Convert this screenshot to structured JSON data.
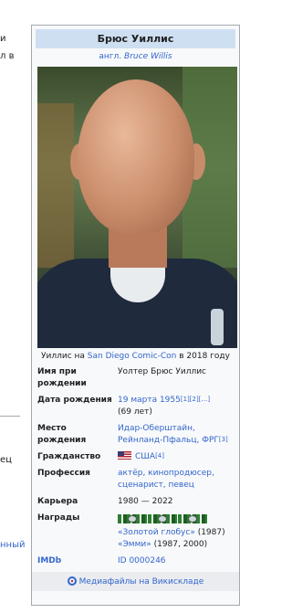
{
  "left_fragments": [
    {
      "text": "и",
      "link": false
    },
    {
      "text": "л в",
      "link": false
    },
    {
      "text": "ец",
      "link": false
    },
    {
      "text": "нный",
      "link": true
    }
  ],
  "infobox": {
    "title": "Брюс Уиллис",
    "subtitle_prefix": "англ.",
    "subtitle_name": "Bruce Willis",
    "photo_alt": "Bruce Willis photo",
    "caption": {
      "before": "Уиллис на ",
      "link": "San Diego Comic-Con",
      "after": " в 2018 году"
    },
    "rows": [
      {
        "label": "Имя при рождении",
        "value": "Уолтер Брюс Уиллис"
      },
      {
        "label": "Дата рождения",
        "date_link": "19 марта 1955",
        "refs": "[1][2][…]",
        "age": "(69 лет)"
      },
      {
        "label": "Место рождения",
        "place": "Идар-Оберштайн, Рейнланд-Пфальц, ФРГ",
        "ref": "[3]"
      },
      {
        "label": "Гражданство",
        "flag_icon": "us-flag-icon",
        "value": "США",
        "ref": "[4]"
      },
      {
        "label": "Профессия",
        "value": "актёр, кинопродюсер, сценарист, певец"
      },
      {
        "label": "Карьера",
        "value": "1980 — 2022"
      },
      {
        "label": "Награды",
        "ribbon_icons": [
          "golden-globe-ribbon-icon",
          "emmy-ribbon-icon",
          "award-ribbon-icon"
        ],
        "globe": "«Золотой глобус»",
        "globe_years": " (1987)",
        "emmy": "«Эмми»",
        "emmy_years": " (1987, 2000)"
      },
      {
        "label": "IMDb",
        "value": "ID 0000246"
      }
    ],
    "footer": "Медиафайлы на Викискладе",
    "footer_icon": "commons-icon"
  },
  "colors": {
    "link": "#3366cc",
    "title_bg": "#cedff2",
    "border": "#a2a9b1"
  }
}
